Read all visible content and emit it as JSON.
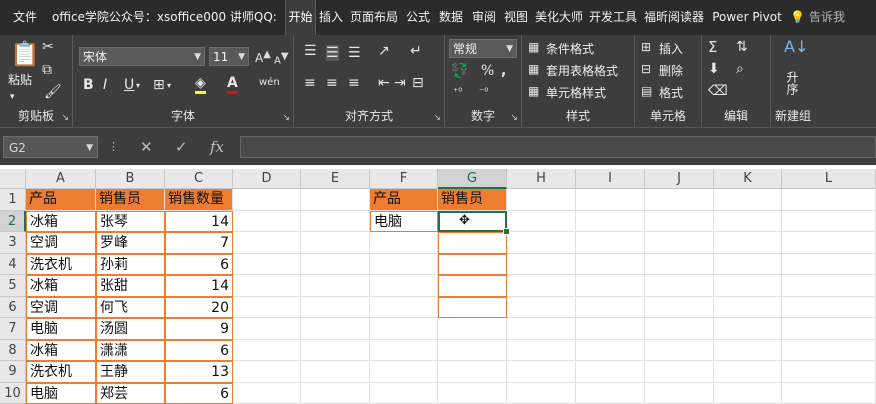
{
  "tabs": [
    {
      "label": "文件",
      "active": false
    },
    {
      "label": "office学院公众号：xsoffice000  讲师QQ:",
      "active": false
    },
    {
      "label": "开始",
      "active": true
    },
    {
      "label": "插入",
      "active": false
    },
    {
      "label": "页面布局",
      "active": false
    },
    {
      "label": "公式",
      "active": false
    },
    {
      "label": "数据",
      "active": false
    },
    {
      "label": "审阅",
      "active": false
    },
    {
      "label": "视图",
      "active": false
    },
    {
      "label": "美化大师",
      "active": false
    },
    {
      "label": "开发工具",
      "active": false
    },
    {
      "label": "福昕阅读器",
      "active": false
    },
    {
      "label": "Power Pivot",
      "active": false
    },
    {
      "label": "告诉我",
      "active": false
    }
  ],
  "ribbon": {
    "clipboard": {
      "paste": "粘贴",
      "group": "剪贴板"
    },
    "font": {
      "name": "宋体",
      "size": "11",
      "bold": "B",
      "italic": "I",
      "underline": "U",
      "wen": "wén",
      "group": "字体"
    },
    "alignment": {
      "group": "对齐方式"
    },
    "number": {
      "format": "常规",
      "group": "数字"
    },
    "styles": {
      "conditional": "条件格式",
      "table": "套用表格格式",
      "cell": "单元格样式",
      "group": "样式"
    },
    "cells": {
      "insert": "插入",
      "delete": "删除",
      "format": "格式",
      "group": "单元格"
    },
    "editing": {
      "sort": "升序",
      "group": "编辑"
    },
    "newgroup": {
      "group": "新建组"
    }
  },
  "formula_bar": {
    "name_box": "G2",
    "cancel": "✕",
    "enter": "✓",
    "fx": "fx",
    "value": ""
  },
  "columns": [
    "A",
    "B",
    "C",
    "D",
    "E",
    "F",
    "G",
    "H",
    "I",
    "J",
    "K",
    "L"
  ],
  "rows": [
    "1",
    "2",
    "3",
    "4",
    "5",
    "6",
    "7",
    "8",
    "9",
    "10"
  ],
  "table": {
    "headers": [
      "产品",
      "销售员",
      "销售数量"
    ],
    "rows": [
      [
        "冰箱",
        "张琴",
        "14"
      ],
      [
        "空调",
        "罗峰",
        "7"
      ],
      [
        "洗衣机",
        "孙莉",
        "6"
      ],
      [
        "冰箱",
        "张甜",
        "14"
      ],
      [
        "空调",
        "何飞",
        "20"
      ],
      [
        "电脑",
        "汤圆",
        "9"
      ],
      [
        "冰箱",
        "潇潇",
        "6"
      ],
      [
        "洗衣机",
        "王静",
        "13"
      ],
      [
        "电脑",
        "郑芸",
        "6"
      ]
    ]
  },
  "lookup": {
    "headers": [
      "产品",
      "销售员"
    ],
    "product": "电脑"
  },
  "colors": {
    "accent": "#217346",
    "header_fill": "#ed7d31",
    "ribbon_bg": "#3d3d3d",
    "tab_bg": "#2b2b2b"
  }
}
